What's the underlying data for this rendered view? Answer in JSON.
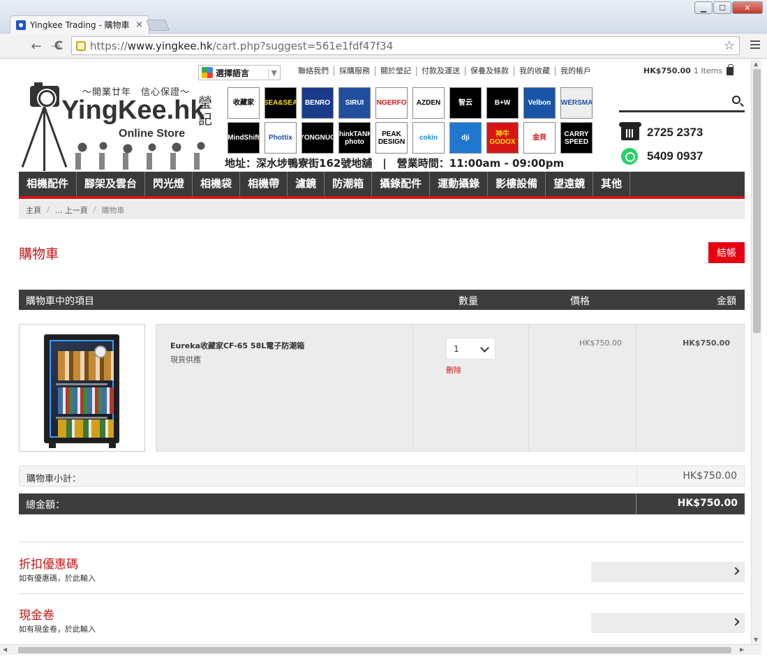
{
  "browser": {
    "tab_title": "Yingkee Trading - 購物車",
    "tab_close": "×",
    "url_scheme": "https://",
    "url_host": "www.yingkee.hk",
    "url_path": "/cart.php?suggest=561e1fdf47f34",
    "window_buttons": {
      "minimize": "▁",
      "maximize": "☐",
      "close": "✕"
    },
    "back": "←",
    "forward": "→",
    "reload": "C",
    "star": "☆"
  },
  "top": {
    "language_label": "選擇語言",
    "language_arrow": "▼",
    "links": [
      "聯絡我們",
      "採購服務",
      "關於瑩記",
      "付款及運送",
      "保養及條款",
      "我的收藏",
      "我的帳戶"
    ],
    "cart_amount": "HK$750.00",
    "cart_items": "1 Items"
  },
  "header": {
    "slogan": "～開業廿年　信心保證～",
    "brand_name": "YingKee.hk",
    "brand_cn": "瑩記",
    "brand_sub": "Online Store",
    "address": "地址：深水埗鴨寮街162號地舖　|　營業時間：11:00am - 09:00pm",
    "phone": "2725 2373",
    "whatsapp": "5409 0937",
    "brands": [
      {
        "label": "收藏家",
        "bg": "#ffffff",
        "fg": "#000000"
      },
      {
        "label": "SEA&SEA",
        "bg": "#000000",
        "fg": "#ffdd00"
      },
      {
        "label": "BENRO",
        "bg": "#1a3a8a",
        "fg": "#ffffff"
      },
      {
        "label": "SIRUI",
        "bg": "#1f4f9e",
        "fg": "#ffffff"
      },
      {
        "label": "SUNGERFOTO",
        "bg": "#ffffff",
        "fg": "#d81414"
      },
      {
        "label": "AZDEN",
        "bg": "#ffffff",
        "fg": "#000000"
      },
      {
        "label": "智云",
        "bg": "#000000",
        "fg": "#ffffff"
      },
      {
        "label": "B+W",
        "bg": "#000000",
        "fg": "#ffffff"
      },
      {
        "label": "Velbon",
        "bg": "#1955a6",
        "fg": "#ffffff"
      },
      {
        "label": "POWERSMART",
        "bg": "#eeeeee",
        "fg": "#1f4fa6"
      },
      {
        "label": "MindShift",
        "bg": "#000000",
        "fg": "#ffffff"
      },
      {
        "label": "Phottix",
        "bg": "#ffffff",
        "fg": "#1f4fa6"
      },
      {
        "label": "YONGNUO",
        "bg": "#000000",
        "fg": "#ffffff"
      },
      {
        "label": "thinkTANK photo",
        "bg": "#000000",
        "fg": "#ffffff"
      },
      {
        "label": "PEAK DESIGN",
        "bg": "#ffffff",
        "fg": "#000000"
      },
      {
        "label": "cokin",
        "bg": "#ffffff",
        "fg": "#1f8fd0"
      },
      {
        "label": "dji",
        "bg": "#1f78d0",
        "fg": "#ffffff"
      },
      {
        "label": "神牛 GODOX",
        "bg": "#d81414",
        "fg": "#ffdd00"
      },
      {
        "label": "金貝",
        "bg": "#ffffff",
        "fg": "#d81414"
      },
      {
        "label": "CARRY SPEED",
        "bg": "#000000",
        "fg": "#ffffff"
      }
    ]
  },
  "nav": [
    "相機配件",
    "腳架及雲台",
    "閃光燈",
    "相機袋",
    "相機帶",
    "濾鏡",
    "防潮箱",
    "攝錄配件",
    "運動攝錄",
    "影樓設備",
    "望遠鏡",
    "其他"
  ],
  "breadcrumb": {
    "home": "主頁",
    "sep": "/",
    "prev": "... 上一頁",
    "current": "購物車"
  },
  "page": {
    "title": "購物車",
    "checkout_label": "結帳"
  },
  "cart": {
    "headers": {
      "item": "購物車中的項目",
      "qty": "數量",
      "price": "價格",
      "amount": "金額"
    },
    "items": [
      {
        "name": "Eureka收藏家CF-65 58L電子防潮箱",
        "stock": "現貨供應",
        "qty": "1",
        "remove": "刪除",
        "price": "HK$750.00",
        "amount": "HK$750.00"
      }
    ],
    "subtotal_label": "購物車小計：",
    "subtotal_value": "HK$750.00",
    "total_label": "總金額：",
    "total_value": "HK$750.00"
  },
  "discount": {
    "title": "折扣優惠碼",
    "desc": "如有優惠碼，於此輸入"
  },
  "voucher": {
    "title": "現金卷",
    "desc": "如有現金卷，於此輸入"
  },
  "colors": {
    "accent": "#e60012",
    "dark_bar": "#3d3d3d",
    "light_bg": "#ececec"
  }
}
